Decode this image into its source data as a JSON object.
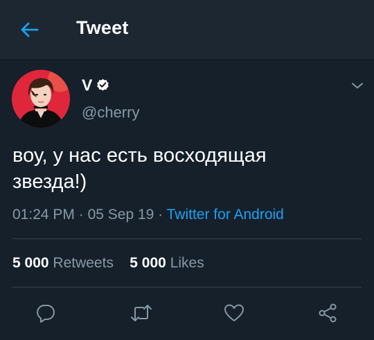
{
  "header": {
    "title": "Tweet",
    "back_icon": "arrow-left-icon",
    "accent_color": "#1da1f2"
  },
  "tweet": {
    "author": {
      "display_name": "V",
      "handle": "@cherry",
      "verified": true
    },
    "text_line1": "воу, у нас есть восходящая",
    "text_line2": "звезда!)",
    "time": "01:24 PM",
    "sep1": " · ",
    "date": "05 Sep 19",
    "sep2": " · ",
    "client": "Twitter for Android",
    "retweets_count": "5 000",
    "retweets_label": "Retweets",
    "likes_count": "5 000",
    "likes_label": "Likes"
  },
  "actions": [
    "reply-icon",
    "retweet-icon",
    "like-icon",
    "share-icon"
  ],
  "colors": {
    "background": "#15202b",
    "header_bg": "#1c2732",
    "secondary_text": "#8899a6",
    "link": "#1da1f2",
    "divider": "#38444d"
  }
}
